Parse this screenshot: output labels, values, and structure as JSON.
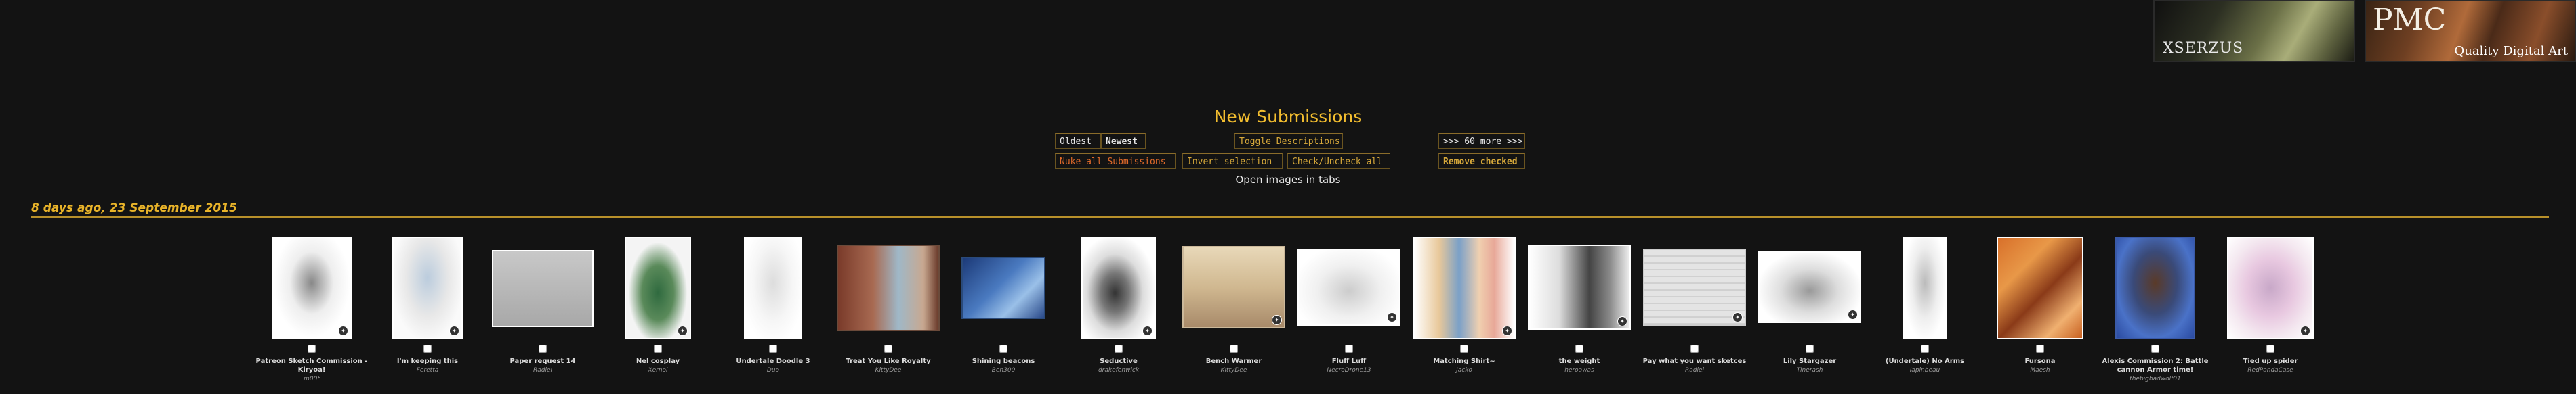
{
  "banners": {
    "left_text": "XSERZUS",
    "right_logo": "PMC",
    "right_caption": "Quality Digital Art"
  },
  "page_title": "New Submissions",
  "controls": {
    "oldest": "Oldest",
    "newest": "Newest",
    "toggle_descriptions": "Toggle Descriptions",
    "more": ">>> 60 more >>>",
    "nuke_all": "Nuke all Submissions",
    "invert_selection": "Invert selection",
    "check_uncheck_all": "Check/Uncheck all",
    "remove_checked": "Remove checked"
  },
  "open_in_tabs": "Open images in tabs",
  "date_header": "8 days ago, 23 September 2015",
  "submissions": [
    {
      "title": "Patreon Sketch Commission - Kiryoa!",
      "artist": "m00t"
    },
    {
      "title": "I'm keeping this",
      "artist": "Feretta"
    },
    {
      "title": "Paper request 14",
      "artist": "Radiel"
    },
    {
      "title": "Nel cosplay",
      "artist": "Xernol"
    },
    {
      "title": "Undertale Doodle 3",
      "artist": "Duo"
    },
    {
      "title": "Treat You Like Royalty",
      "artist": "KittyDee"
    },
    {
      "title": "Shining beacons",
      "artist": "Ben300"
    },
    {
      "title": "Seductive",
      "artist": "drakefenwick"
    },
    {
      "title": "Bench Warmer",
      "artist": "KittyDee"
    },
    {
      "title": "Fluff Luff",
      "artist": "NecroDrone13"
    },
    {
      "title": "Matching Shirt~",
      "artist": "Jacko"
    },
    {
      "title": "the weight",
      "artist": "heroawas"
    },
    {
      "title": "Pay what you want sketces",
      "artist": "Radiel"
    },
    {
      "title": "Lily Stargazer",
      "artist": "Tinerash"
    },
    {
      "title": "(Undertale) No Arms",
      "artist": "lapinbeau"
    },
    {
      "title": "Fursona",
      "artist": "Maesh"
    },
    {
      "title": "Alexis Commission 2: Battle cannon Armor time!",
      "artist": "thebigbadwolf01"
    },
    {
      "title": "Tied up spider",
      "artist": "RedPandaCase"
    }
  ],
  "colors": {
    "background": "#131313",
    "accent_gold": "#f2bd2f",
    "date_gold": "#e8b329",
    "nuke_orange": "#e06a2a"
  }
}
